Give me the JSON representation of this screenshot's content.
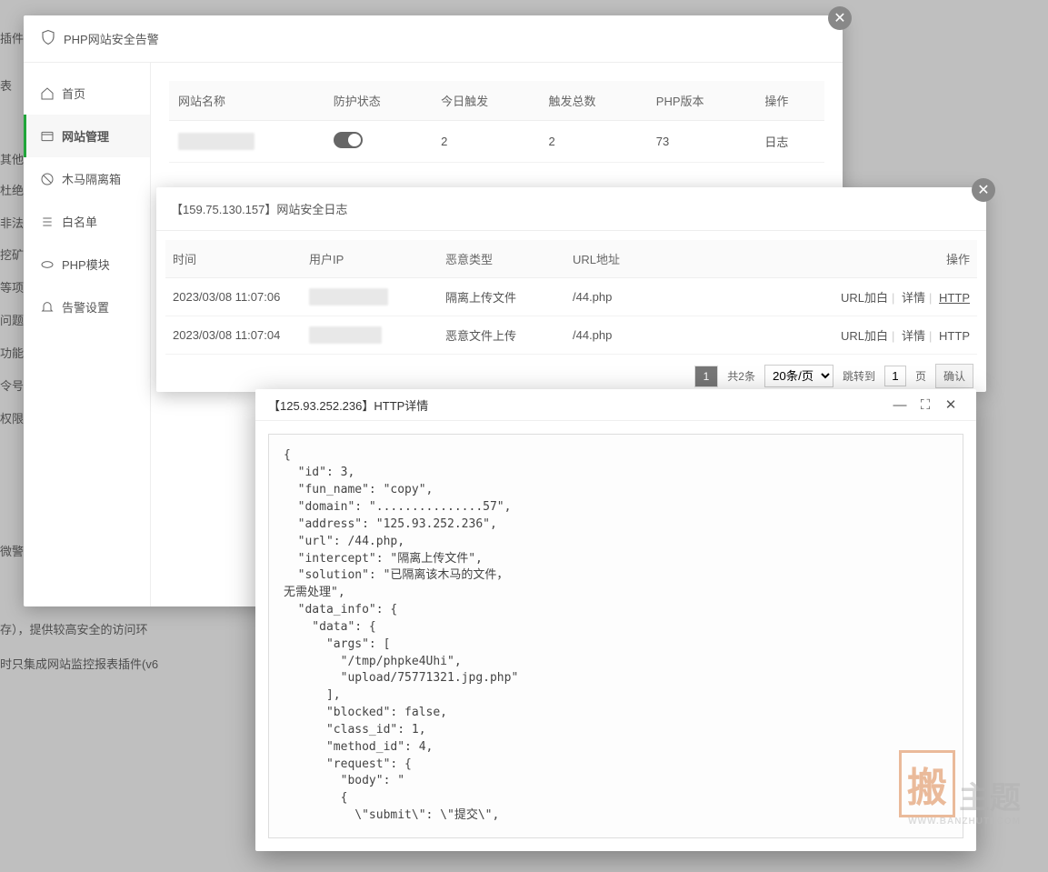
{
  "bg": {
    "t1": "插件",
    "t2": "表",
    "t3": "其他",
    "t4": "杜绝",
    "t5": "非法",
    "t6": "挖矿",
    "t7": "等项",
    "t8": "问题",
    "t9": "功能+",
    "t10": "令号",
    "t11": "权限",
    "t13": "微警",
    "t14": "存），提供较高安全的访问环",
    "t15": "时只集成网站监控报表插件(v6"
  },
  "modal1": {
    "title": "PHP网站安全告警",
    "nav": {
      "home": "首页",
      "site": "网站管理",
      "quarantine": "木马隔离箱",
      "whitelist": "白名单",
      "php": "PHP模块",
      "alert": "告警设置"
    },
    "cols": {
      "name": "网站名称",
      "status": "防护状态",
      "today": "今日触发",
      "total": "触发总数",
      "ver": "PHP版本",
      "ops": "操作"
    },
    "row": {
      "name_mask": "159...............",
      "today": "2",
      "total": "2",
      "ver": "73",
      "log": "日志"
    }
  },
  "modal2": {
    "title": "【159.75.130.157】网站安全日志",
    "cols": {
      "time": "时间",
      "ip": "用户IP",
      "type": "恶意类型",
      "url": "URL地址",
      "ops": "操作"
    },
    "rows": [
      {
        "time": "2023/03/08 11:07:06",
        "ip_mask": "1..................6",
        "type": "隔离上传文件",
        "url": "/44.php"
      },
      {
        "time": "2023/03/08 11:07:04",
        "ip_mask": "1..................",
        "type": "恶意文件上传",
        "url": "/44.php"
      }
    ],
    "ops": {
      "white": "URL加白",
      "detail": "详情",
      "http": "HTTP"
    },
    "pager": {
      "page": "1",
      "total": "共2条",
      "per": "20条/页",
      "jump": "跳转到",
      "jv": "1",
      "pg": "页",
      "ok": "确认"
    }
  },
  "modal3": {
    "title": "【125.93.252.236】HTTP详情",
    "code": "{\n  \"id\": 3,\n  \"fun_name\": \"copy\",\n  \"domain\": \"...............57\",\n  \"address\": \"125.93.252.236\",\n  \"url\": /44.php,\n  \"intercept\": \"隔离上传文件\",\n  \"solution\": \"已隔离该木马的文件，\n无需处理\",\n  \"data_info\": {\n    \"data\": {\n      \"args\": [\n        \"/tmp/phpke4Uhi\",\n        \"upload/75771321.jpg.php\"\n      ],\n      \"blocked\": false,\n      \"class_id\": 1,\n      \"method_id\": 4,\n      \"request\": {\n        \"body\": \"\n        {\n          \\\"submit\\\": \\\"提交\\\","
  },
  "wm": {
    "logo": "搬",
    "txt": "主题",
    "url": "WWW.BANZHUTI.COM"
  }
}
